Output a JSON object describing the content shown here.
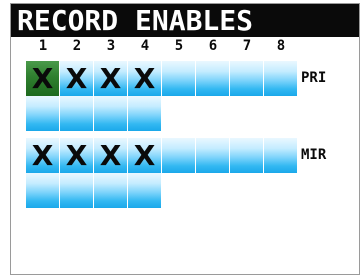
{
  "screen": {
    "title": "RECORD ENABLES"
  },
  "tracks": [
    "1",
    "2",
    "3",
    "4",
    "5",
    "6",
    "7",
    "8"
  ],
  "rows": [
    {
      "label": "PRI",
      "cells": [
        "X",
        "X",
        "X",
        "X",
        "",
        "",
        "",
        ""
      ],
      "selected_index": 0
    },
    {
      "label": "",
      "cells": [
        "",
        "",
        "",
        ""
      ],
      "selected_index": null
    },
    {
      "label": "MIR",
      "cells": [
        "X",
        "X",
        "X",
        "X",
        "",
        "",
        "",
        ""
      ],
      "selected_index": null
    },
    {
      "label": "",
      "cells": [
        "",
        "",
        "",
        ""
      ],
      "selected_index": null
    }
  ],
  "colors": {
    "title_bar": "#0a0a0a",
    "cell_blue": "#33b8f2",
    "cell_selected": "#2f7f2f"
  }
}
